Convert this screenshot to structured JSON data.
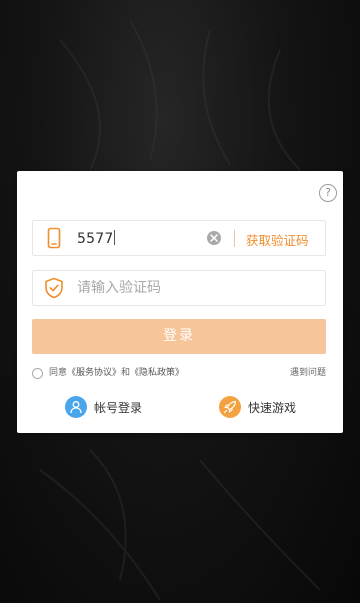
{
  "colors": {
    "accent": "#f08d2c",
    "login_button_bg": "#f7c59a",
    "account_icon_bg": "#4aa6eb",
    "quick_icon_bg": "#f3a23f",
    "overlay_bg": "#141414"
  },
  "dialog": {
    "help_label": "?",
    "phone_field": {
      "icon": "phone-icon",
      "value": "5577",
      "clear_icon": "clear-icon",
      "get_code_label": "获取验证码"
    },
    "code_field": {
      "icon": "shield-check-icon",
      "value": "",
      "placeholder": "请输入验证码"
    },
    "login_label": "登录",
    "agreement": {
      "prefix": "同意",
      "terms": "《服务协议》",
      "and": "和",
      "privacy": "《隐私政策》",
      "problem": "遇到问题"
    },
    "alt_logins": {
      "account": {
        "icon": "user-icon",
        "label": "帐号登录"
      },
      "quick": {
        "icon": "rocket-icon",
        "label": "快速游戏"
      }
    }
  }
}
